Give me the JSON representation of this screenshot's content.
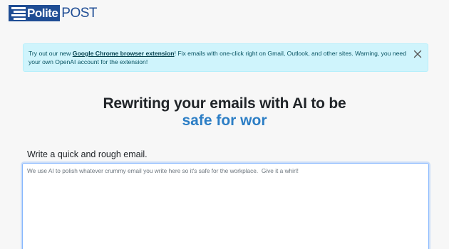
{
  "logo": {
    "left_text": "Polite",
    "right_text": "POST",
    "brand_color": "#1f4d94"
  },
  "alert": {
    "prefix": "Try out our new ",
    "link_text": "Google Chrome browser extension",
    "suffix": "! Fix emails with one-click right on Gmail, Outlook, and other sites. Warning, you need your own OpenAI account for the extension!",
    "close_icon": "close-icon",
    "bg_color": "#cff4fc"
  },
  "hero": {
    "title": "Rewriting your emails with AI to be",
    "typed_text": "safe for wor",
    "accent_color": "#2c7ec5"
  },
  "form": {
    "label": "Write a quick and rough email.",
    "placeholder": "We use AI to polish whatever crummy email you write here so it's safe for the workplace.  Give it a whirl!",
    "value": ""
  }
}
